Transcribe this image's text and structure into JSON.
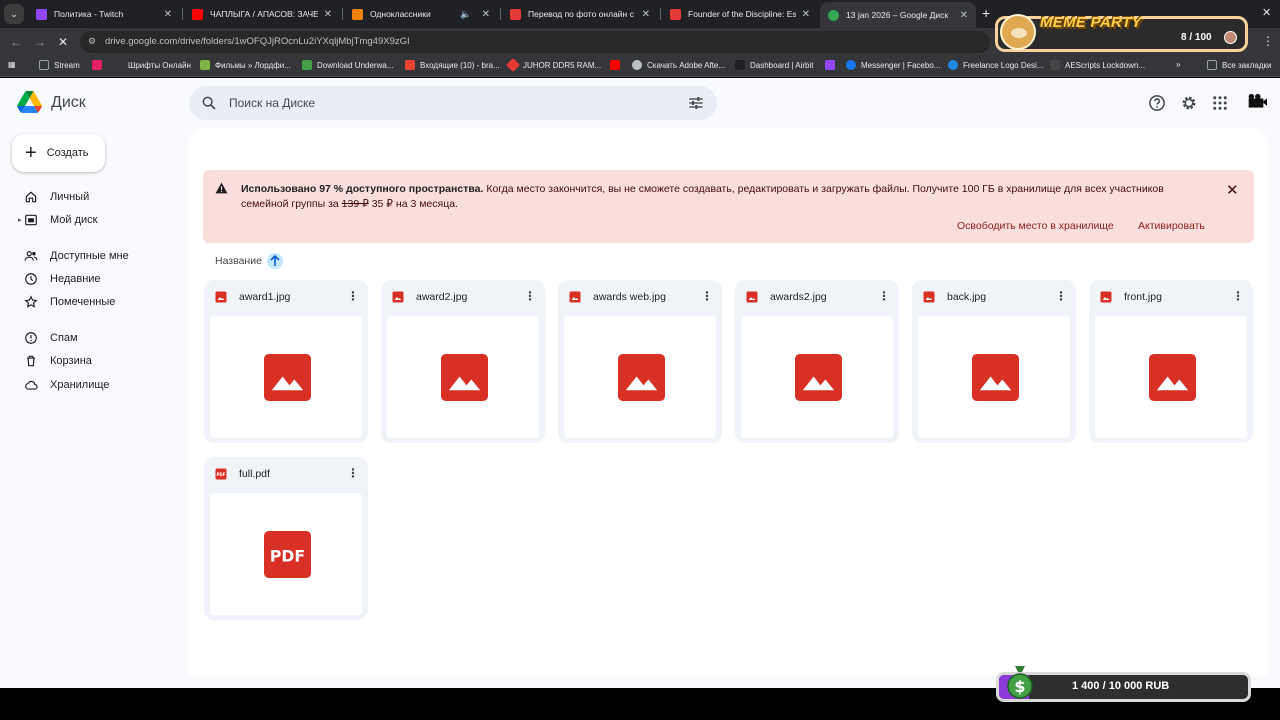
{
  "browser": {
    "tabs": [
      {
        "title": "Политика - Twitch",
        "color": "#9146ff"
      },
      {
        "title": "ЧАПЛЫГА / АПАСОВ: ЗАЧЕМ Г",
        "color": "#ff0000"
      },
      {
        "title": "Одноклассники",
        "color": "#ee8208"
      },
      {
        "title": "Перевод по фото онлайн с ан",
        "color": "#e53935"
      },
      {
        "title": "Founder of the Discipline: Est",
        "color": "#e53935"
      },
      {
        "title": "13 jan 2026 – Google Диск",
        "color": "#34a853"
      }
    ],
    "url": "drive.google.com/drive/folders/1wOFQJjROcnLu2iYXqljMbjTmg49X9zGI",
    "bookmarks": [
      {
        "label": "Stream",
        "color": "#9aa0a6"
      },
      {
        "label": "",
        "color": "#e91e63"
      },
      {
        "label": "Шрифты Онлайн",
        "color": "#ffffff"
      },
      {
        "label": "Фильмы » Лордфи...",
        "color": "#7cb342"
      },
      {
        "label": "Download Underwa...",
        "color": "#43a047"
      },
      {
        "label": "Входящие (10) - bra...",
        "color": "#ea4335"
      },
      {
        "label": "JUHOR DDR5 RAM...",
        "color": "#e53935"
      },
      {
        "label": "",
        "color": "#ff0000"
      },
      {
        "label": "Скачать Adobe Afte...",
        "color": "#bdc1c6"
      },
      {
        "label": "Dashboard | Airbit",
        "color": "#202124"
      },
      {
        "label": "",
        "color": "#9146ff"
      },
      {
        "label": "Messenger | Facebo...",
        "color": "#1877f2"
      },
      {
        "label": "Freelance Logo Desi...",
        "color": "#1e88e5"
      },
      {
        "label": "AEScripts Lockdown...",
        "color": "#444"
      }
    ],
    "all_bookmarks": "Все закладки"
  },
  "overlay": {
    "meme_title": "MEME PARTY",
    "meme_count": "8 / 100",
    "rub_progress": "1 400 / 10 000 RUB"
  },
  "drive": {
    "brand": "Диск",
    "search_placeholder": "Поиск на Диске",
    "create_label": "Создать",
    "nav": [
      {
        "label": "Личный",
        "icon": "home-icon"
      },
      {
        "label": "Мой диск",
        "icon": "my-drive-icon"
      },
      {
        "label": "Доступные мне",
        "icon": "shared-icon"
      },
      {
        "label": "Недавние",
        "icon": "clock-icon"
      },
      {
        "label": "Помеченные",
        "icon": "star-icon"
      },
      {
        "label": "Спам",
        "icon": "spam-icon"
      },
      {
        "label": "Корзина",
        "icon": "trash-icon"
      },
      {
        "label": "Хранилище",
        "icon": "cloud-icon"
      }
    ],
    "banner": {
      "bold": "Использовано 97 % доступного пространства.",
      "text1": " Когда место закончится, вы не сможете создавать, редактировать и загружать файлы. Получите 100 ГБ в хранилище для всех участников семейной группы за ",
      "old_price": "139 ₽",
      "text2": " 35 ₽ на 3 месяца.",
      "free_space": "Освободить место в хранилище",
      "activate": "Активировать"
    },
    "sort_label": "Название",
    "files": [
      {
        "name": "award1.jpg",
        "type": "image"
      },
      {
        "name": "award2.jpg",
        "type": "image"
      },
      {
        "name": "awards web.jpg",
        "type": "image"
      },
      {
        "name": "awards2.jpg",
        "type": "image"
      },
      {
        "name": "back.jpg",
        "type": "image"
      },
      {
        "name": "front.jpg",
        "type": "image"
      },
      {
        "name": "full.pdf",
        "type": "pdf"
      }
    ],
    "accent": "#d93025"
  }
}
